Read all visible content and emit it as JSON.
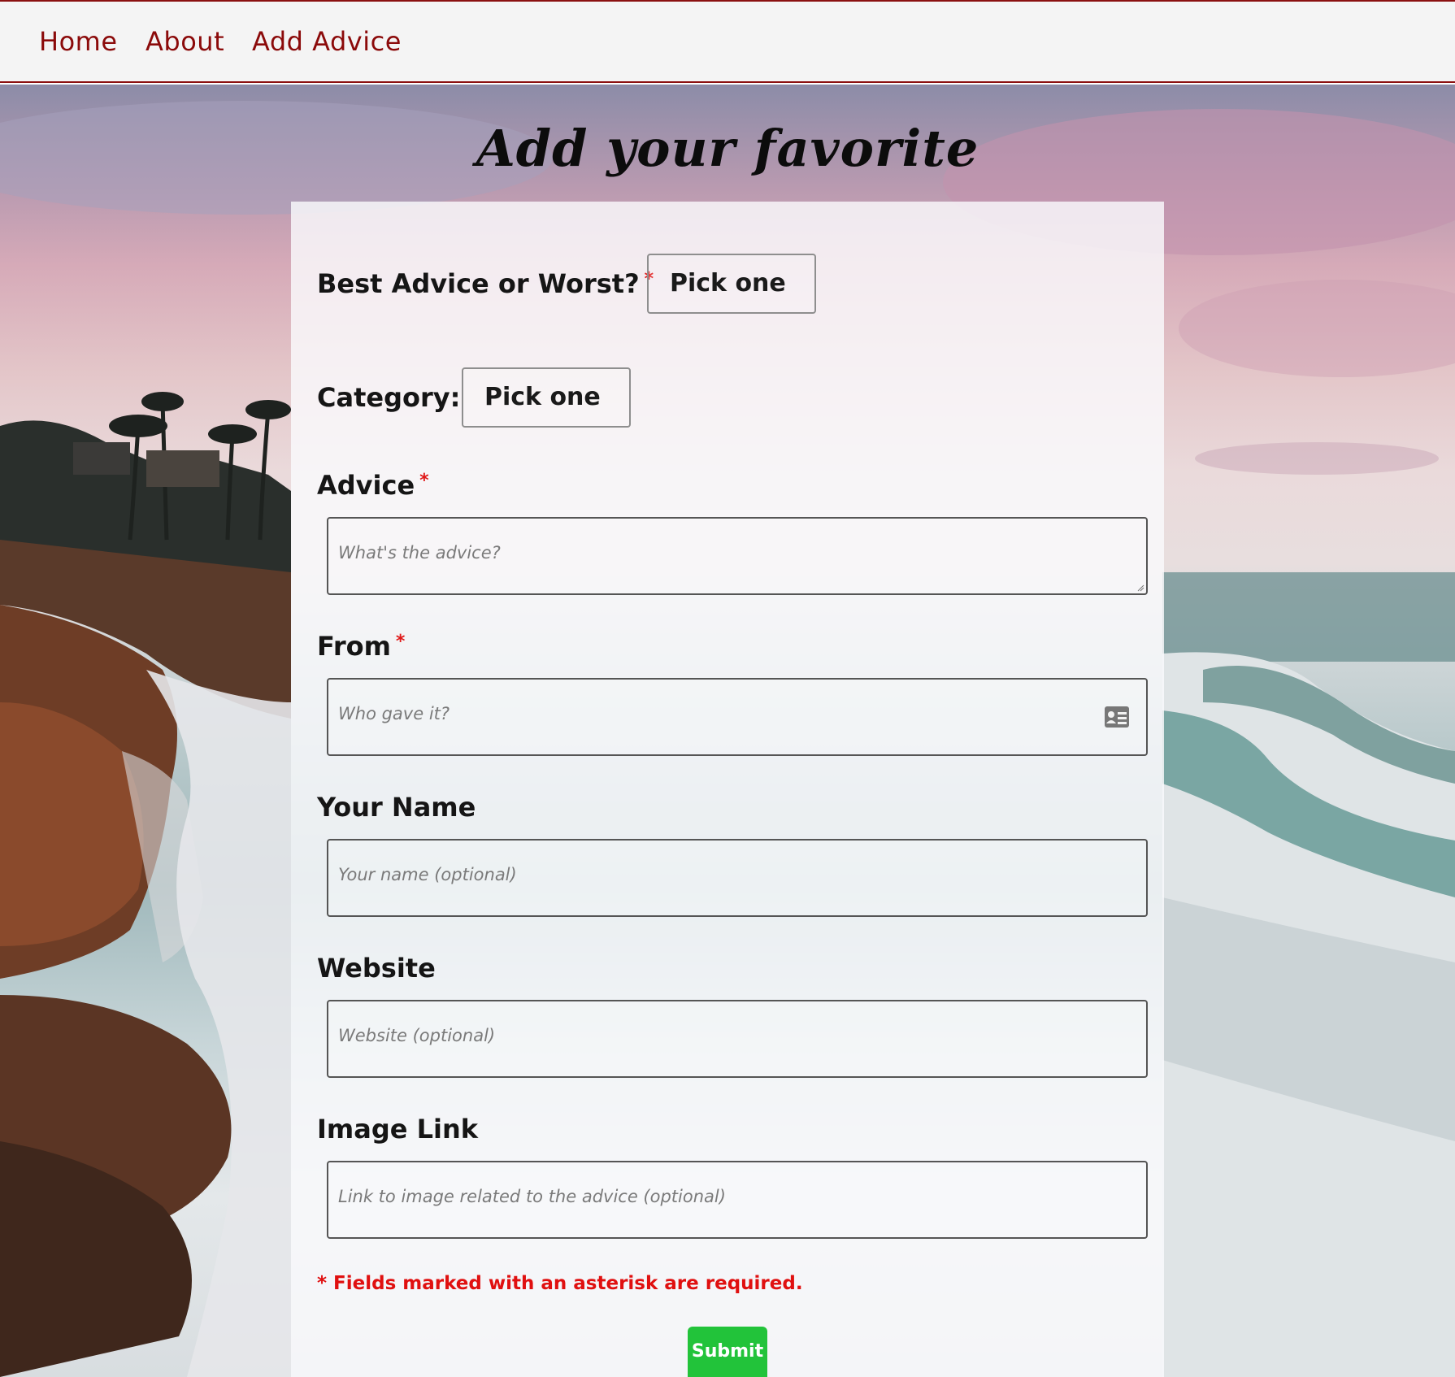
{
  "nav": {
    "home": "Home",
    "about": "About",
    "add_advice": "Add Advice"
  },
  "page": {
    "title": "Add your favorite"
  },
  "form": {
    "type_label": "Best Advice or Worst?",
    "type_value": "Pick one",
    "category_label": "Category:",
    "category_value": "Pick one",
    "advice_label": "Advice",
    "advice_placeholder": "What's the advice?",
    "from_label": "From",
    "from_placeholder": "Who gave it?",
    "name_label": "Your Name",
    "name_placeholder": "Your name (optional)",
    "website_label": "Website",
    "website_placeholder": "Website (optional)",
    "image_label": "Image Link",
    "image_placeholder": "Link to image related to the advice (optional)",
    "required_marker": "*",
    "required_note": "* Fields marked with an asterisk are required.",
    "submit_label": "Submit"
  },
  "colors": {
    "nav_text": "#8b0a0a",
    "required": "#e01010",
    "submit_bg": "#22c33a"
  }
}
